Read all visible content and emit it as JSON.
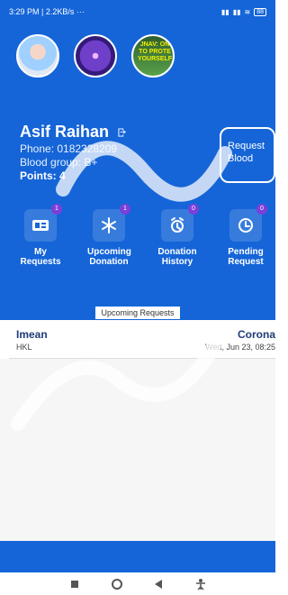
{
  "status_bar": {
    "time_speed": "3:29 PM | 2.2KB/s",
    "dots": "···",
    "battery": "88"
  },
  "stories": [
    {
      "name": "story-1"
    },
    {
      "name": "story-2"
    },
    {
      "name": "story-3",
      "text": "JNAV: ON TO PROTE YOURSELF"
    }
  ],
  "profile": {
    "name": "Asif Raihan",
    "phone": "Phone: 0182328209",
    "blood_group": "Blood group: B+",
    "points": "Points: 4"
  },
  "request_blood_button": {
    "line1": "Request",
    "line2": "Blood"
  },
  "actions": [
    {
      "label1": "My",
      "label2": "Requests",
      "badge": "1",
      "icon": "grid-card-icon"
    },
    {
      "label1": "Upcoming",
      "label2": "Donation",
      "badge": "1",
      "icon": "snowflake-icon"
    },
    {
      "label1": "Donation",
      "label2": "History",
      "badge": "0",
      "icon": "alarm-clock-icon"
    },
    {
      "label1": "Pending",
      "label2": "Request",
      "badge": "0",
      "icon": "clock-icon"
    }
  ],
  "upcoming": {
    "title": "Upcoming Requests",
    "items": [
      {
        "name": "Imean",
        "location": "HKL",
        "disease": "Corona",
        "datetime": "Wed, Jun 23, 08:25"
      }
    ]
  },
  "colors": {
    "primary_blue": "#1565d8",
    "badge_purple": "#7b3fd9",
    "text_dark_blue": "#1f3b77"
  },
  "nav_icons": [
    "square-icon",
    "circle-icon",
    "back-triangle-icon",
    "accessibility-icon"
  ]
}
